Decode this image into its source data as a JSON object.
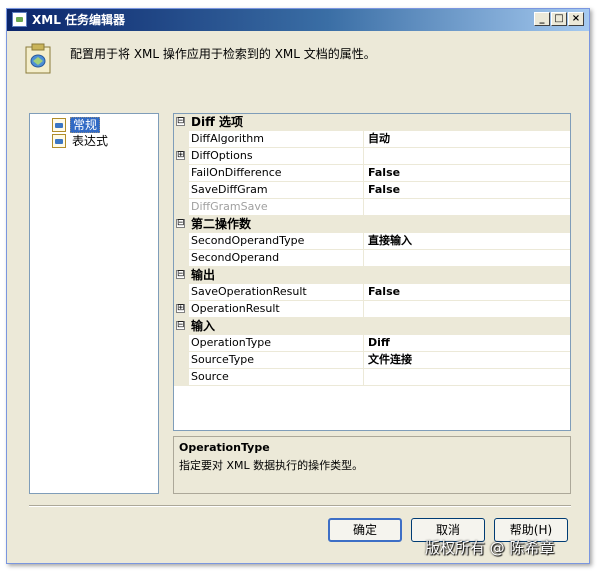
{
  "window": {
    "title": "XML 任务编辑器",
    "minimize": "_",
    "maximize": "□",
    "close": "×"
  },
  "header": {
    "description": "配置用于将 XML 操作应用于检索到的 XML 文档的属性。"
  },
  "nav": {
    "items": [
      {
        "label": "常规",
        "selected": true
      },
      {
        "label": "表达式",
        "selected": false
      }
    ]
  },
  "properties": {
    "categories": [
      {
        "name": "Diff 选项",
        "rows": [
          {
            "name": "DiffAlgorithm",
            "value": "自动"
          },
          {
            "name": "DiffOptions",
            "value": "",
            "expandable": true
          },
          {
            "name": "FailOnDifference",
            "value": "False"
          },
          {
            "name": "SaveDiffGram",
            "value": "False"
          },
          {
            "name": "DiffGramSave",
            "value": "",
            "disabled": true
          }
        ]
      },
      {
        "name": "第二操作数",
        "rows": [
          {
            "name": "SecondOperandType",
            "value": "直接输入"
          },
          {
            "name": "SecondOperand",
            "value": ""
          }
        ]
      },
      {
        "name": "输出",
        "rows": [
          {
            "name": "SaveOperationResult",
            "value": "False"
          },
          {
            "name": "OperationResult",
            "value": "",
            "expandable": true
          }
        ]
      },
      {
        "name": "输入",
        "rows": [
          {
            "name": "OperationType",
            "value": "Diff"
          },
          {
            "name": "SourceType",
            "value": "文件连接"
          },
          {
            "name": "Source",
            "value": ""
          }
        ]
      }
    ]
  },
  "description_panel": {
    "title": "OperationType",
    "text": "指定要对 XML 数据执行的操作类型。"
  },
  "buttons": {
    "ok": "确定",
    "cancel": "取消",
    "help": "帮助(H)"
  },
  "watermark": "版权所有 @ 陈希章",
  "icons": {
    "expanded": "⊟",
    "collapsed": "⊞"
  }
}
